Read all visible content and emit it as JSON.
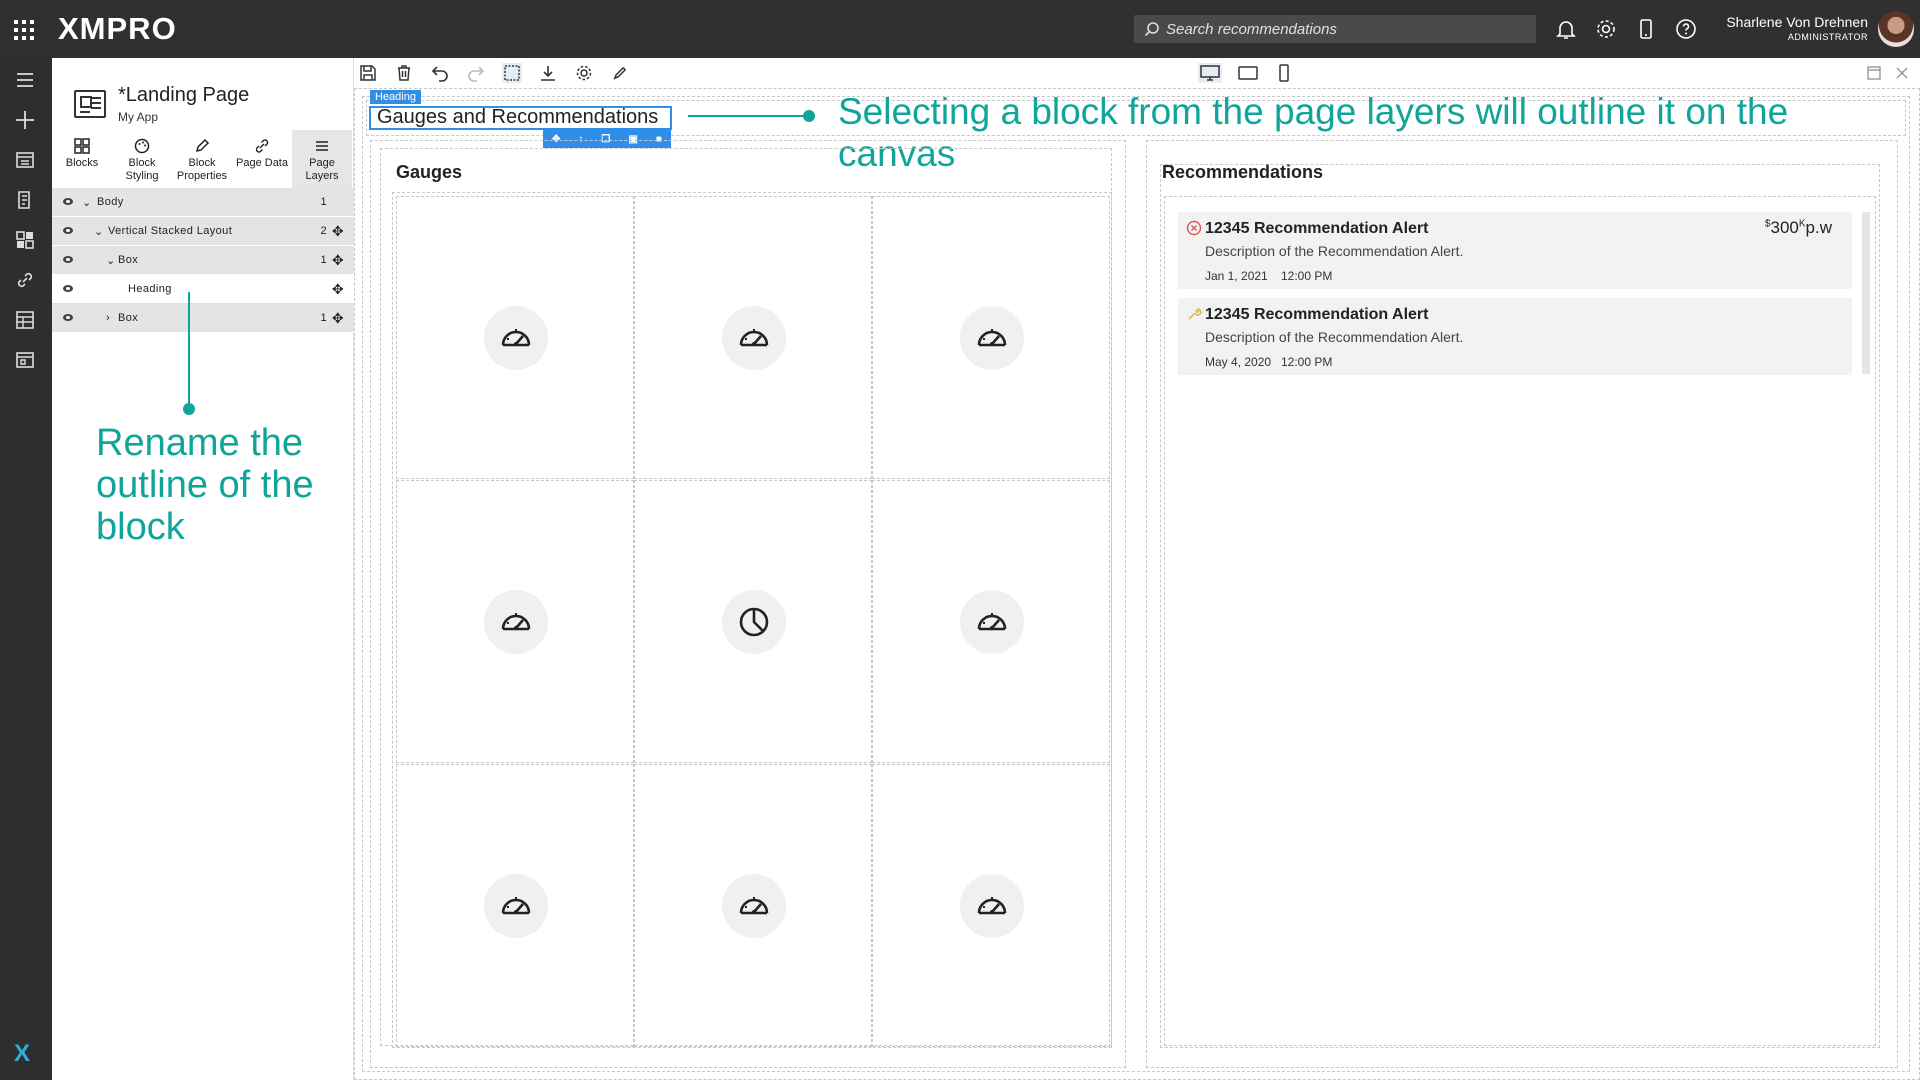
{
  "header": {
    "logo": "XMPRO",
    "search_placeholder": "Search recommendations",
    "user_name": "Sharlene Von Drehnen",
    "user_role": "ADMINISTRATOR"
  },
  "sidebar": {
    "page_title": "*Landing Page",
    "app_name": "My App",
    "tabs": [
      {
        "line1": "Blocks",
        "line2": ""
      },
      {
        "line1": "Block",
        "line2": "Styling"
      },
      {
        "line1": "Block",
        "line2": "Properties"
      },
      {
        "line1": "Page Data",
        "line2": ""
      },
      {
        "line1": "Page",
        "line2": "Layers"
      }
    ],
    "layers": [
      {
        "label": "Body",
        "count": "1"
      },
      {
        "label": "Vertical Stacked Layout",
        "count": "2"
      },
      {
        "label": "Box",
        "count": "1"
      },
      {
        "label": "Heading",
        "count": ""
      },
      {
        "label": "Box",
        "count": "1"
      }
    ]
  },
  "annotations": {
    "left": "Rename the outline of the block",
    "top": "Selecting a block from the page layers will outline it on the canvas"
  },
  "canvas": {
    "heading_tag": "Heading",
    "heading_text": "Gauges and Recommendations",
    "gauges_title": "Gauges",
    "recommendations_title": "Recommendations",
    "recommendations": [
      {
        "title": "12345 Recommendation Alert",
        "description": "Description of the Recommendation Alert.",
        "date": "Jan 1, 2021",
        "time": "12:00 PM",
        "price_currency": "$",
        "price_value": "300",
        "price_unit_sup": "K",
        "price_suffix": "p.w",
        "status": "error",
        "status_color": "#e05555"
      },
      {
        "title": "12345 Recommendation Alert",
        "description": "Description of the Recommendation Alert.",
        "date": "May 4, 2020",
        "time": "12:00 PM",
        "status": "wrench",
        "status_color": "#e0b84a"
      }
    ]
  },
  "colors": {
    "accent": "#0fa59a",
    "selection": "#2f8ee8",
    "topbar": "#303030"
  }
}
